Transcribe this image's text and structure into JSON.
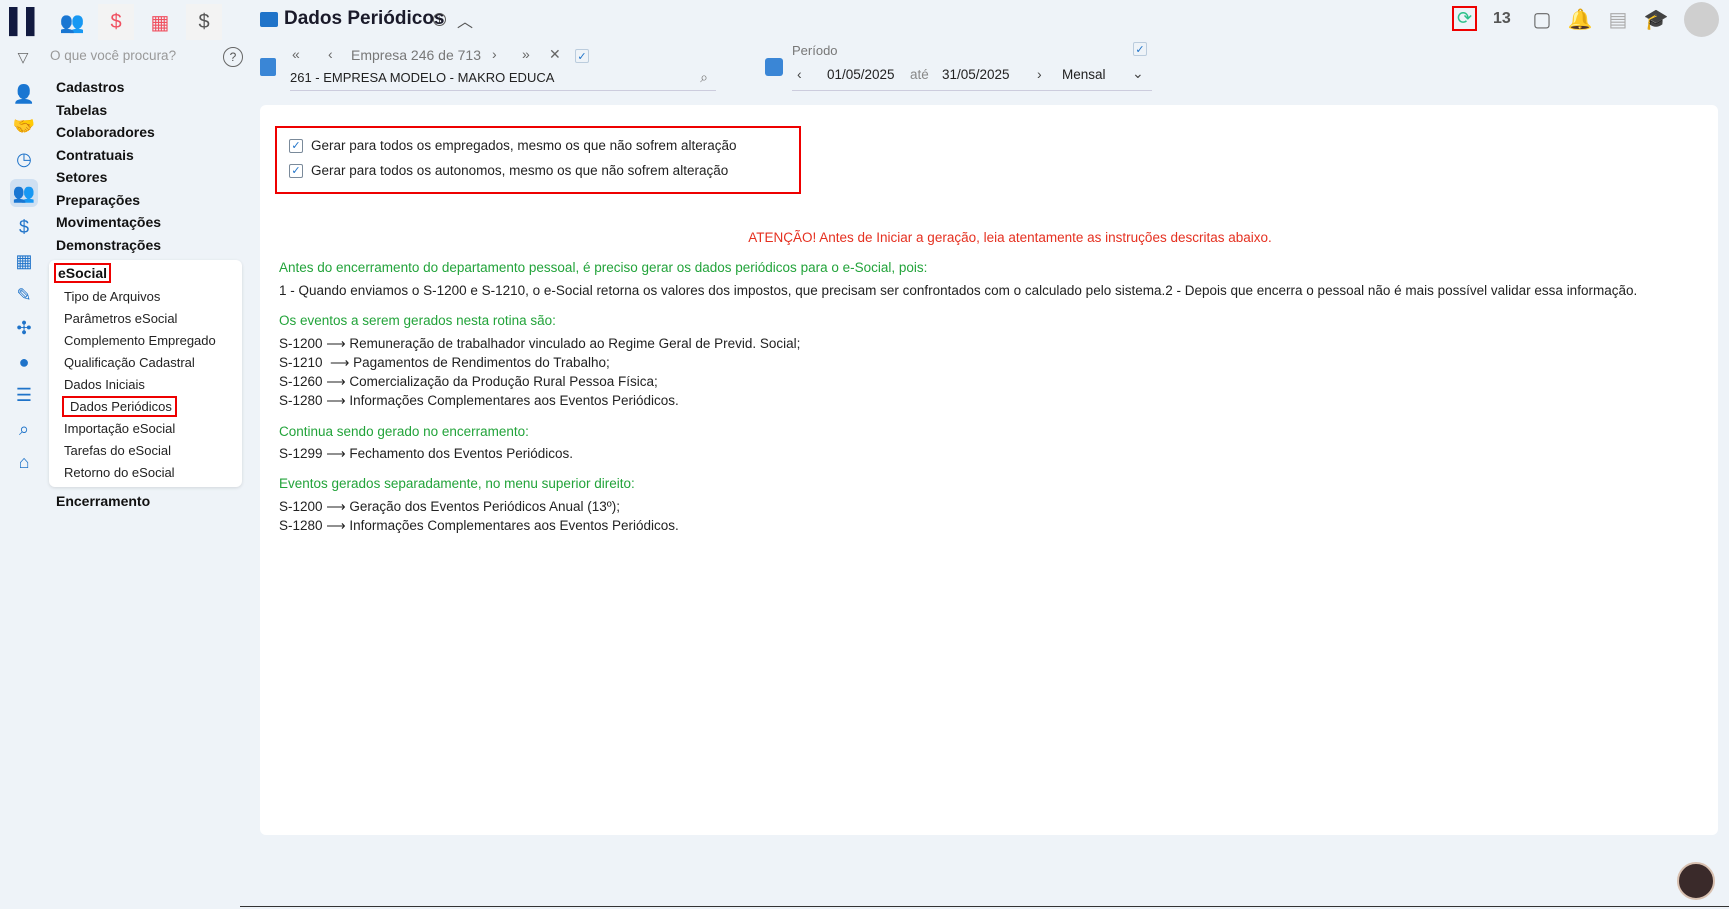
{
  "app": {
    "title": "Dados Periódicos"
  },
  "topbar": {
    "notification_count": "13"
  },
  "search": {
    "placeholder": "O que você procura?"
  },
  "nav": {
    "company_counter": "Empresa 246 de 713",
    "company_name": "261 - EMPRESA MODELO - MAKRO EDUCA"
  },
  "period": {
    "label": "Período",
    "start": "01/05/2025",
    "sep": "até",
    "end": "31/05/2025",
    "type": "Mensal"
  },
  "menu": {
    "items": [
      "Cadastros",
      "Tabelas",
      "Colaboradores",
      "Contratuais",
      "Setores",
      "Preparações",
      "Movimentações",
      "Demonstrações"
    ],
    "esocial": "eSocial",
    "esocial_sub": [
      "Tipo de Arquivos",
      "Parâmetros eSocial",
      "Complemento Empregado",
      "Qualificação Cadastral",
      "Dados Iniciais",
      "Dados Periódicos",
      "Importação eSocial",
      "Tarefas do eSocial",
      "Retorno do eSocial"
    ],
    "last": "Encerramento"
  },
  "options": {
    "employees": "Gerar para todos os empregados, mesmo os que não sofrem alteração",
    "autonomous": "Gerar para todos os autonomos, mesmo os que não sofrem alteração"
  },
  "content": {
    "warning": "ATENÇÃO! Antes de Iniciar a geração, leia atentamente as instruções descritas abaixo.",
    "intro": "Antes do encerramento do departamento pessoal, é preciso gerar os dados periódicos para o e-Social, pois:",
    "intro_text": "1 - Quando enviamos o S-1200 e S-1210, o e-Social retorna os valores dos impostos, que precisam ser confrontados com o calculado pelo sistema.2 - Depois que encerra o pessoal não é mais possível validar essa informação.",
    "h1": "Os eventos a serem gerados nesta rotina são:",
    "l1": [
      "S-1200 ⟶ Remuneração de trabalhador vinculado ao Regime Geral de Previd. Social;",
      "S-1210  ⟶ Pagamentos de Rendimentos do Trabalho;",
      "S-1260 ⟶ Comercialização da Produção Rural Pessoa Física;",
      "S-1280 ⟶ Informações Complementares aos Eventos Periódicos."
    ],
    "h2": "Continua sendo gerado no encerramento:",
    "l2": [
      "S-1299 ⟶ Fechamento dos Eventos Periódicos."
    ],
    "h3": "Eventos gerados separadamente, no menu superior direito:",
    "l3": [
      "S-1200 ⟶ Geração dos Eventos Periódicos Anual (13º);",
      "S-1280 ⟶ Informações Complementares aos Eventos Periódicos."
    ]
  },
  "colors": {
    "accent": "#1f73c9",
    "green": "#22a33a",
    "red": "#e53020"
  }
}
